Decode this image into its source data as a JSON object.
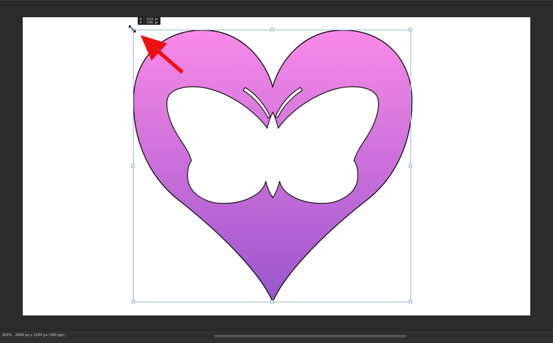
{
  "canvas": {
    "background": "#ffffff",
    "workspace_color": "#282828"
  },
  "artwork": {
    "heart_gradient_top": "#f98ae8",
    "heart_gradient_bottom": "#9a55cc",
    "outline_color": "#111111",
    "cutout": "butterfly"
  },
  "transform": {
    "box_color": "#9fb6d8",
    "tooltip_width": "W : 1114 px",
    "tooltip_height": "H : 1105 px"
  },
  "annotation": {
    "arrow_color": "#ee1111",
    "arrow_icon": "red-arrow-icon"
  },
  "status_bar": {
    "zoom": "200%",
    "doc_info": "2000 px x 1200 px (300 ppi)",
    "menu_arrow": "›"
  }
}
